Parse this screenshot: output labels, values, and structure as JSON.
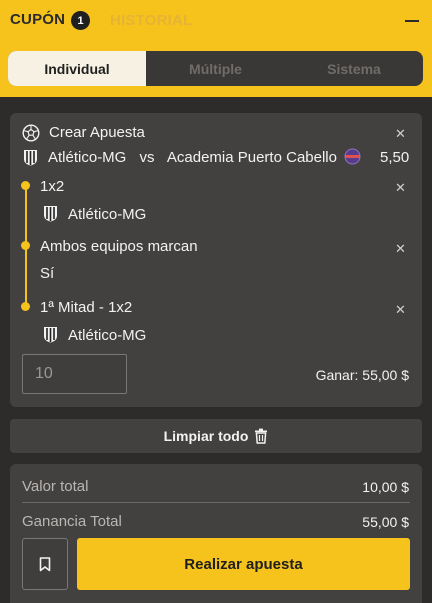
{
  "header": {
    "cupon_label": "CUPÓN",
    "count": "1",
    "historial_label": "HISTORIAL"
  },
  "tabs": [
    {
      "label": "Individual",
      "active": true
    },
    {
      "label": "Múltiple",
      "active": false
    },
    {
      "label": "Sistema",
      "active": false
    }
  ],
  "bet": {
    "title": "Crear Apuesta",
    "home_team": "Atlético-MG",
    "vs": "vs",
    "away_team": "Academia Puerto Cabello",
    "odds": "5,50",
    "selections": [
      {
        "market": "1x2",
        "pick": "Atlético-MG"
      },
      {
        "market": "Ambos equipos marcan",
        "pick": "Sí"
      },
      {
        "market": "1ª Mitad - 1x2",
        "pick": "Atlético-MG"
      }
    ],
    "stake_value": "10",
    "win_label": "Ganar:",
    "win_value": "55,00 $"
  },
  "clear_label": "Limpiar todo",
  "summary": {
    "total_label": "Valor total",
    "total_value": "10,00 $",
    "gain_label": "Ganancia Total",
    "gain_value": "55,00 $",
    "place_bet_label": "Realizar apuesta"
  },
  "colors": {
    "accent": "#f6c21c",
    "background": "#2e2c2a",
    "card": "#434140"
  },
  "icons": {
    "title": "soccer-ball-icon",
    "close": "close-icon",
    "team": "team-crest-icon",
    "clear": "trash-icon",
    "save": "bookmark-icon",
    "collapse": "minimize-icon"
  }
}
